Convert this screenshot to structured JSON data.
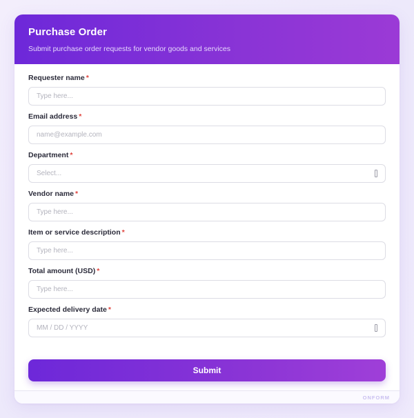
{
  "header": {
    "title": "Purchase Order",
    "subtitle": "Submit purchase order requests for vendor goods and services"
  },
  "fields": [
    {
      "label": "Requester name",
      "required": "*",
      "placeholder": "Type here...",
      "type": "text"
    },
    {
      "label": "Email address",
      "required": "*",
      "placeholder": "name@example.com",
      "type": "email"
    },
    {
      "label": "Department",
      "required": "*",
      "placeholder": "Select...",
      "type": "select"
    },
    {
      "label": "Vendor name",
      "required": "*",
      "placeholder": "Type here...",
      "type": "text"
    },
    {
      "label": "Item or service description",
      "required": "*",
      "placeholder": "Type here...",
      "type": "text"
    },
    {
      "label": "Total amount (USD)",
      "required": "*",
      "placeholder": "Type here...",
      "type": "text"
    },
    {
      "label": "Expected delivery date",
      "required": "*",
      "placeholder": "MM / DD / YYYY",
      "type": "date"
    }
  ],
  "submit_label": "Submit",
  "footer": {
    "brand": "ONFORM"
  },
  "colors": {
    "accent_start": "#6d28d9",
    "accent_end": "#9b3ad6",
    "required": "#e0443e"
  },
  "icons": {
    "select_field": "dropdown-icon",
    "date_field": "calendar-icon"
  }
}
